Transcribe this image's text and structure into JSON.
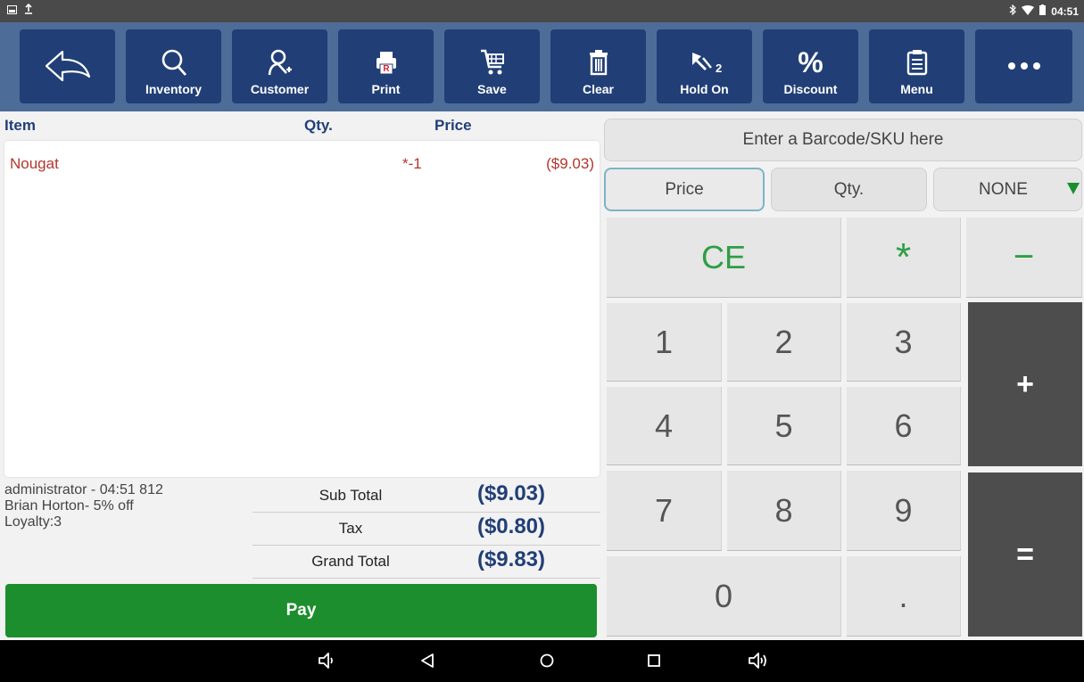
{
  "status": {
    "time": "04:51"
  },
  "toolbar": {
    "inventory": "Inventory",
    "customer": "Customer",
    "print": "Print",
    "save": "Save",
    "clear": "Clear",
    "hold_on": "Hold On",
    "hold_count": "2",
    "discount": "Discount",
    "menu": "Menu"
  },
  "columns": {
    "item": "Item",
    "qty": "Qty.",
    "price": "Price"
  },
  "items": [
    {
      "name": "Nougat",
      "qty": "*-1",
      "price": "($9.03)"
    }
  ],
  "info": {
    "operator": "administrator - 04:51 812",
    "customer": "Brian Horton- 5% off",
    "loyalty": "Loyalty:3"
  },
  "totals": {
    "subtotal_label": "Sub Total",
    "subtotal": "($9.03)",
    "tax_label": "Tax",
    "tax": "($0.80)",
    "grand_label": "Grand Total",
    "grand": "($9.83)"
  },
  "pay_label": "Pay",
  "barcode_placeholder": "Enter a Barcode/SKU here",
  "mode": {
    "price": "Price",
    "qty": "Qty.",
    "selected": "NONE"
  },
  "keypad": {
    "ce": "CE",
    "star": "*",
    "minus": "−",
    "plus": "+",
    "equals": "=",
    "k1": "1",
    "k2": "2",
    "k3": "3",
    "k4": "4",
    "k5": "5",
    "k6": "6",
    "k7": "7",
    "k8": "8",
    "k9": "9",
    "k0": "0",
    "dot": "."
  },
  "colors": {
    "toolbar_bg": "#4d6c97",
    "toolbar_button": "#213f76",
    "pay_green": "#1c8e2d",
    "item_red": "#b3362b",
    "keypad_dark": "#4d4d4d"
  }
}
